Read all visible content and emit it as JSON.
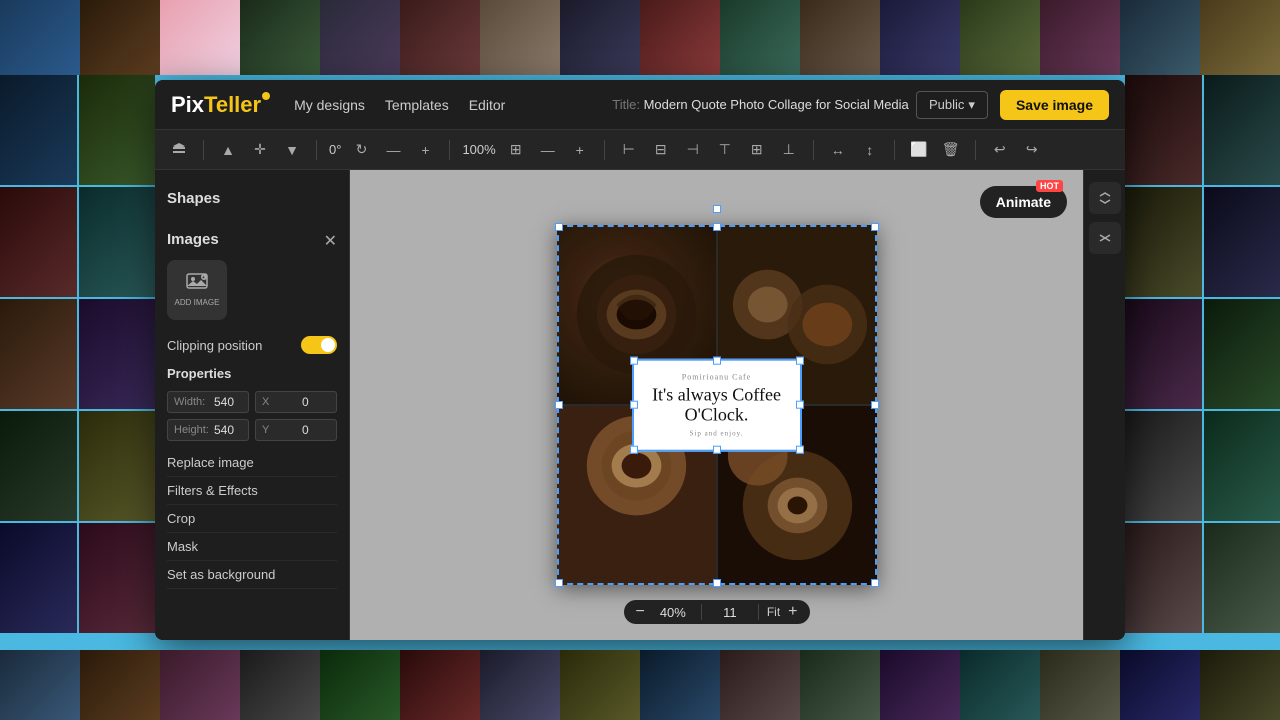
{
  "app": {
    "logo_pix": "Pix",
    "logo_teller": "Teller"
  },
  "nav": {
    "my_designs": "My designs",
    "templates": "Templates",
    "editor": "Editor",
    "title_label": "Title:",
    "title_text": "Modern Quote Photo Collage for Social Media",
    "public_label": "Public",
    "save_label": "Save image"
  },
  "toolbar": {
    "rotation": "0°",
    "zoom": "100%",
    "undo_label": "Undo",
    "redo_label": "Redo"
  },
  "left_panel": {
    "shapes_label": "Shapes",
    "images_label": "Images",
    "add_image_label": "ADD IMAGE",
    "clipping_label": "Clipping position",
    "properties_label": "Properties",
    "width_label": "Width:",
    "width_val": "540",
    "height_label": "Height:",
    "height_val": "540",
    "x_label": "X",
    "x_val": "0",
    "y_label": "Y",
    "y_val": "0",
    "replace_image": "Replace image",
    "filters_effects": "Filters & Effects",
    "crop": "Crop",
    "mask": "Mask",
    "set_as_background": "Set as background"
  },
  "canvas": {
    "cafe_name": "Pomirioanu Cafe",
    "main_text": "It's always Coffee O'Clock.",
    "sub_text": "Sip and enjoy."
  },
  "animate_btn": "Animate",
  "hot_badge": "HOT",
  "zoom": {
    "minus": "−",
    "value": "40%",
    "number": "11",
    "fit": "Fit",
    "plus": "+"
  }
}
